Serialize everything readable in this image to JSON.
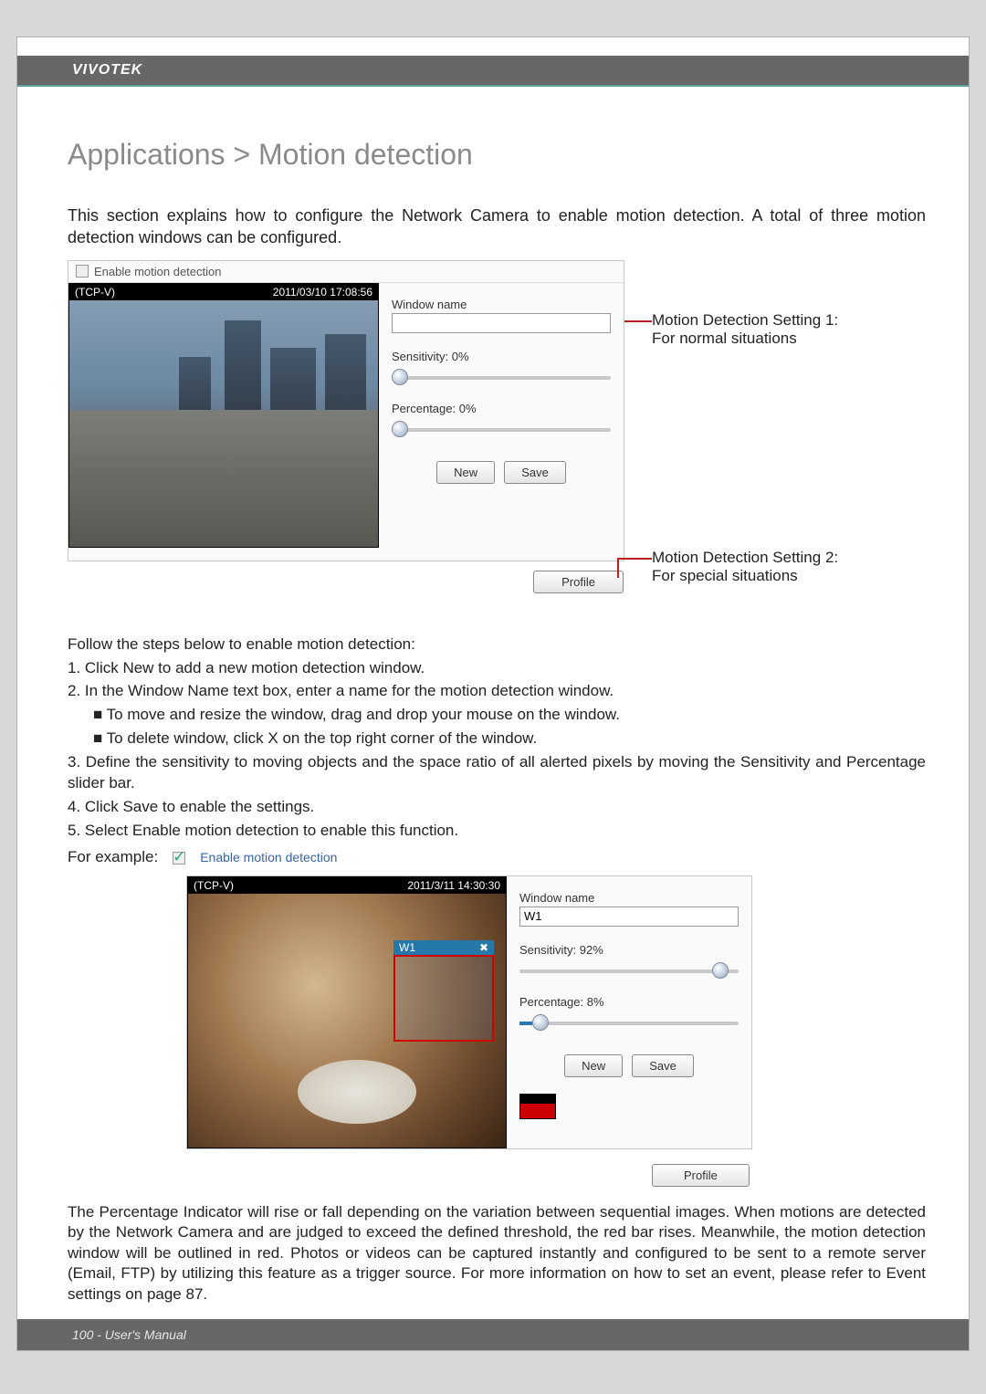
{
  "brand": "VIVOTEK",
  "title": "Applications > Motion detection",
  "intro": "This section explains how to configure the Network Camera to enable motion detection. A total of three motion detection windows can be configured.",
  "panel1": {
    "enable_label": "Enable motion detection",
    "enable_checked": false,
    "stream_name": "(TCP-V)",
    "timestamp": "2011/03/10 17:08:56",
    "window_name_label": "Window name",
    "window_name_value": "",
    "sensitivity_label": "Sensitivity: 0%",
    "sensitivity_pct": 0,
    "percentage_label": "Percentage: 0%",
    "percentage_pct": 0,
    "btn_new": "New",
    "btn_save": "Save",
    "btn_profile": "Profile"
  },
  "anno1_line1": "Motion Detection Setting 1:",
  "anno1_line2": "For normal situations",
  "anno2_line1": "Motion Detection Setting 2:",
  "anno2_line2": "For special situations",
  "steps_intro": "Follow the steps below to enable motion detection:",
  "steps": {
    "s1": "1. Click New to add a new motion detection window.",
    "s2": "2. In the Window Name text box, enter a name for the motion detection window.",
    "s2a": "■ To move and resize the window, drag and drop your mouse on the window.",
    "s2b": "■ To delete window, click X on the top right corner of the window.",
    "s3": "3. Define the sensitivity to moving objects and the space ratio of all alerted pixels by moving the Sensitivity and Percentage slider bar.",
    "s4": "4. Click Save to enable the settings.",
    "s5": "5. Select Enable motion detection    to enable this function."
  },
  "for_example": "For example:",
  "example_enable_label": "Enable motion detection",
  "panel2": {
    "stream_name": "(TCP-V)",
    "timestamp": "2011/3/11 14:30:30",
    "window_name_label": "Window name",
    "window_name_value": "W1",
    "motion_box_label": "W1",
    "motion_box_close": "✖",
    "sensitivity_label": "Sensitivity: 92%",
    "sensitivity_pct": 92,
    "percentage_label": "Percentage: 8%",
    "percentage_pct": 8,
    "btn_new": "New",
    "btn_save": "Save",
    "btn_profile": "Profile"
  },
  "para2": "The Percentage Indicator will rise or fall depending on the variation between sequential images. When motions are detected by the Network Camera and are judged to exceed the defined threshold, the red bar rises. Meanwhile, the motion detection window will be outlined in red. Photos or videos can be captured instantly and configured to be sent to a remote server (Email, FTP) by utilizing this feature as a trigger source. For more information on how to set an event, please refer to Event settings on page 87.",
  "footer": "100 - User's Manual"
}
